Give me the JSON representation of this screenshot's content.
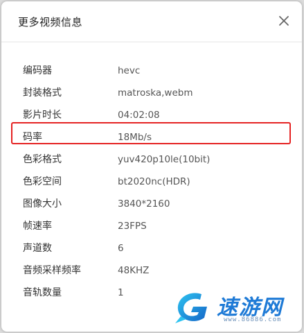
{
  "dialog": {
    "title": "更多视频信息",
    "close_icon": "close-icon"
  },
  "info_rows": [
    {
      "label": "编码器",
      "value": "hevc"
    },
    {
      "label": "封装格式",
      "value": "matroska,webm"
    },
    {
      "label": "影片时长",
      "value": "04:02:08"
    },
    {
      "label": "码率",
      "value": "18Mb/s"
    },
    {
      "label": "色彩格式",
      "value": "yuv420p10le(10bit)"
    },
    {
      "label": "色彩空间",
      "value": "bt2020nc(HDR)"
    },
    {
      "label": "图像大小",
      "value": "3840*2160"
    },
    {
      "label": "帧速率",
      "value": "23FPS"
    },
    {
      "label": "声道数",
      "value": "6"
    },
    {
      "label": "音频采样频率",
      "value": "48KHZ"
    },
    {
      "label": "音轨数量",
      "value": "1"
    }
  ],
  "highlight": {
    "row_label": "码率",
    "color": "#e52222"
  },
  "watermark": {
    "name": "速游网",
    "url": "www.86886.com",
    "logo_icon": "g-logo-icon"
  }
}
